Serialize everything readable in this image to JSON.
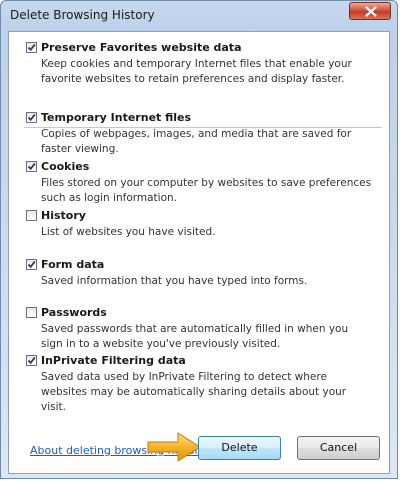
{
  "window": {
    "title": "Delete Browsing History",
    "close_icon": "close-icon"
  },
  "items": [
    {
      "label": "Preserve Favorites website data",
      "checked": true,
      "description": "Keep cookies and temporary Internet files that enable your favorite websites to retain preferences and display faster."
    },
    {
      "label": "Temporary Internet files",
      "checked": true,
      "description": "Copies of webpages, images, and media that are saved for faster viewing."
    },
    {
      "label": "Cookies",
      "checked": true,
      "description": "Files stored on your computer by websites to save preferences such as login information."
    },
    {
      "label": "History",
      "checked": false,
      "description": "List of websites you have visited."
    },
    {
      "label": "Form data",
      "checked": true,
      "description": "Saved information that you have typed into forms."
    },
    {
      "label": "Passwords",
      "checked": false,
      "description": "Saved passwords that are automatically filled in when you sign in to a website you've previously visited."
    },
    {
      "label": "InPrivate Filtering data",
      "checked": true,
      "description": "Saved data used by InPrivate Filtering to detect where websites may be automatically sharing details about your visit."
    }
  ],
  "footer": {
    "help_link": "About deleting browsing history",
    "delete_label": "Delete",
    "cancel_label": "Cancel"
  },
  "colors": {
    "accent_arrow": "#f2a71b",
    "link": "#1d5cc0"
  }
}
